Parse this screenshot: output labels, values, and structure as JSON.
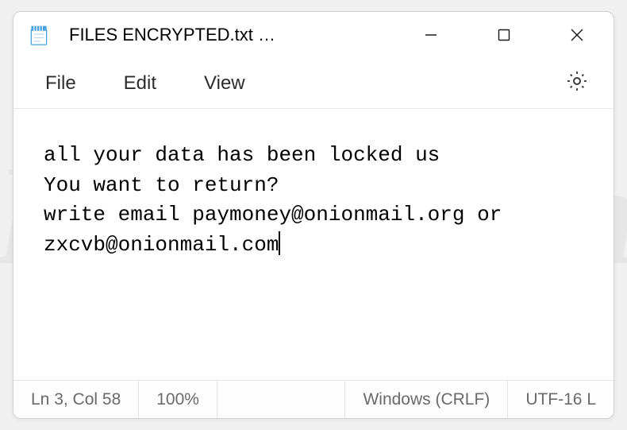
{
  "titlebar": {
    "title": "FILES ENCRYPTED.txt …"
  },
  "menubar": {
    "file": "File",
    "edit": "Edit",
    "view": "View"
  },
  "content": {
    "text": "all your data has been locked us\nYou want to return?\nwrite email paymoney@onionmail.org or zxcvb@onionmail.com"
  },
  "statusbar": {
    "position": "Ln 3, Col 58",
    "zoom": "100%",
    "line_ending": "Windows (CRLF)",
    "encoding": "UTF-16 L"
  },
  "watermark": "PCrisk.com"
}
